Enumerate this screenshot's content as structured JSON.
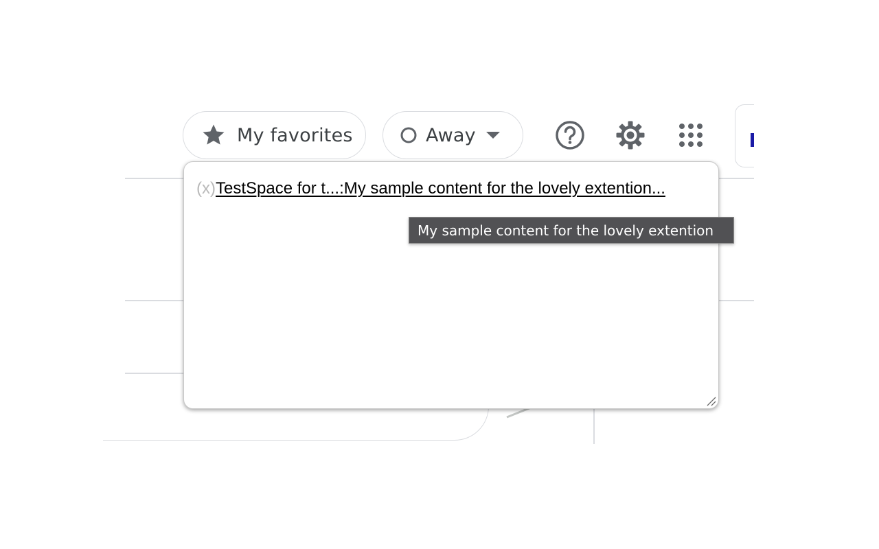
{
  "header": {
    "favorites_label": "My favorites",
    "status_label": "Away",
    "icons": {
      "favorites": "star-icon",
      "status": "circle-outline-icon",
      "status_dropdown": "caret-down-icon",
      "help": "help-icon",
      "settings": "gear-icon",
      "apps": "apps-grid-icon"
    }
  },
  "popup": {
    "remove_label": "(x)",
    "entry_label": "TestSpace for t...:My sample content for the lovely extention..."
  },
  "tooltip": {
    "text": "My sample content for the lovely extention"
  },
  "colors": {
    "icon_gray": "#5f6368",
    "border": "#dadce0",
    "tooltip_bg": "#515154",
    "account_accent": "#1a1aa6"
  }
}
